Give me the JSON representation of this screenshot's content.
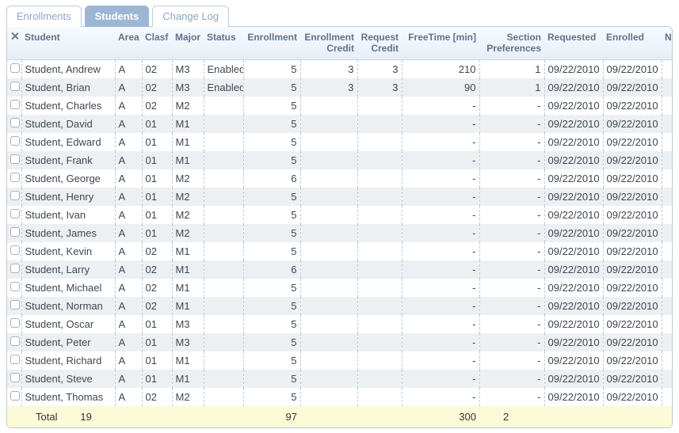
{
  "tabs": {
    "t0": "Enrollments",
    "t1": "Students",
    "t2": "Change Log",
    "activeIndex": 1
  },
  "columns": {
    "student": "Student",
    "area": "Area",
    "clasf": "Clasf",
    "major": "Major",
    "status": "Status",
    "enrollment": "Enrollment",
    "enrollment_credit": "Enrollment Credit",
    "request_credit": "Request Credit",
    "freetime": "FreeTime [min]",
    "section_prefs": "Section Preferences",
    "requested": "Requested",
    "enrolled": "Enrolled",
    "note": "Note"
  },
  "rows": [
    {
      "student": "Student, Andrew",
      "area": "A",
      "clasf": "02",
      "major": "M3",
      "status": "Enabled",
      "enrollment": "5",
      "ecr": "3",
      "rcr": "3",
      "free": "210",
      "pref": "1",
      "req": "09/22/2010",
      "enrd": "09/22/2010"
    },
    {
      "student": "Student, Brian",
      "area": "A",
      "clasf": "02",
      "major": "M3",
      "status": "Enabled",
      "enrollment": "5",
      "ecr": "3",
      "rcr": "3",
      "free": "90",
      "pref": "1",
      "req": "09/22/2010",
      "enrd": "09/22/2010"
    },
    {
      "student": "Student, Charles",
      "area": "A",
      "clasf": "02",
      "major": "M2",
      "status": "",
      "enrollment": "5",
      "ecr": "",
      "rcr": "",
      "free": "-",
      "pref": "-",
      "req": "09/22/2010",
      "enrd": "09/22/2010"
    },
    {
      "student": "Student, David",
      "area": "A",
      "clasf": "01",
      "major": "M1",
      "status": "",
      "enrollment": "5",
      "ecr": "",
      "rcr": "",
      "free": "-",
      "pref": "-",
      "req": "09/22/2010",
      "enrd": "09/22/2010"
    },
    {
      "student": "Student, Edward",
      "area": "A",
      "clasf": "01",
      "major": "M1",
      "status": "",
      "enrollment": "5",
      "ecr": "",
      "rcr": "",
      "free": "-",
      "pref": "-",
      "req": "09/22/2010",
      "enrd": "09/22/2010"
    },
    {
      "student": "Student, Frank",
      "area": "A",
      "clasf": "01",
      "major": "M1",
      "status": "",
      "enrollment": "5",
      "ecr": "",
      "rcr": "",
      "free": "-",
      "pref": "-",
      "req": "09/22/2010",
      "enrd": "09/22/2010"
    },
    {
      "student": "Student, George",
      "area": "A",
      "clasf": "01",
      "major": "M2",
      "status": "",
      "enrollment": "6",
      "ecr": "",
      "rcr": "",
      "free": "-",
      "pref": "-",
      "req": "09/22/2010",
      "enrd": "09/22/2010"
    },
    {
      "student": "Student, Henry",
      "area": "A",
      "clasf": "01",
      "major": "M2",
      "status": "",
      "enrollment": "5",
      "ecr": "",
      "rcr": "",
      "free": "-",
      "pref": "-",
      "req": "09/22/2010",
      "enrd": "09/22/2010"
    },
    {
      "student": "Student, Ivan",
      "area": "A",
      "clasf": "01",
      "major": "M2",
      "status": "",
      "enrollment": "5",
      "ecr": "",
      "rcr": "",
      "free": "-",
      "pref": "-",
      "req": "09/22/2010",
      "enrd": "09/22/2010"
    },
    {
      "student": "Student, James",
      "area": "A",
      "clasf": "01",
      "major": "M2",
      "status": "",
      "enrollment": "5",
      "ecr": "",
      "rcr": "",
      "free": "-",
      "pref": "-",
      "req": "09/22/2010",
      "enrd": "09/22/2010"
    },
    {
      "student": "Student, Kevin",
      "area": "A",
      "clasf": "02",
      "major": "M1",
      "status": "",
      "enrollment": "5",
      "ecr": "",
      "rcr": "",
      "free": "-",
      "pref": "-",
      "req": "09/22/2010",
      "enrd": "09/22/2010"
    },
    {
      "student": "Student, Larry",
      "area": "A",
      "clasf": "02",
      "major": "M1",
      "status": "",
      "enrollment": "6",
      "ecr": "",
      "rcr": "",
      "free": "-",
      "pref": "-",
      "req": "09/22/2010",
      "enrd": "09/22/2010"
    },
    {
      "student": "Student, Michael",
      "area": "A",
      "clasf": "02",
      "major": "M1",
      "status": "",
      "enrollment": "5",
      "ecr": "",
      "rcr": "",
      "free": "-",
      "pref": "-",
      "req": "09/22/2010",
      "enrd": "09/22/2010"
    },
    {
      "student": "Student, Norman",
      "area": "A",
      "clasf": "02",
      "major": "M1",
      "status": "",
      "enrollment": "5",
      "ecr": "",
      "rcr": "",
      "free": "-",
      "pref": "-",
      "req": "09/22/2010",
      "enrd": "09/22/2010"
    },
    {
      "student": "Student, Oscar",
      "area": "A",
      "clasf": "01",
      "major": "M3",
      "status": "",
      "enrollment": "5",
      "ecr": "",
      "rcr": "",
      "free": "-",
      "pref": "-",
      "req": "09/22/2010",
      "enrd": "09/22/2010"
    },
    {
      "student": "Student, Peter",
      "area": "A",
      "clasf": "01",
      "major": "M3",
      "status": "",
      "enrollment": "5",
      "ecr": "",
      "rcr": "",
      "free": "-",
      "pref": "-",
      "req": "09/22/2010",
      "enrd": "09/22/2010"
    },
    {
      "student": "Student, Richard",
      "area": "A",
      "clasf": "01",
      "major": "M1",
      "status": "",
      "enrollment": "5",
      "ecr": "",
      "rcr": "",
      "free": "-",
      "pref": "-",
      "req": "09/22/2010",
      "enrd": "09/22/2010"
    },
    {
      "student": "Student, Steve",
      "area": "A",
      "clasf": "01",
      "major": "M1",
      "status": "",
      "enrollment": "5",
      "ecr": "",
      "rcr": "",
      "free": "-",
      "pref": "-",
      "req": "09/22/2010",
      "enrd": "09/22/2010"
    },
    {
      "student": "Student, Thomas",
      "area": "A",
      "clasf": "02",
      "major": "M2",
      "status": "",
      "enrollment": "5",
      "ecr": "",
      "rcr": "",
      "free": "-",
      "pref": "-",
      "req": "09/22/2010",
      "enrd": "09/22/2010"
    }
  ],
  "totals": {
    "label": "Total",
    "count": "19",
    "enrollment": "97",
    "free": "300",
    "pref": "2"
  }
}
